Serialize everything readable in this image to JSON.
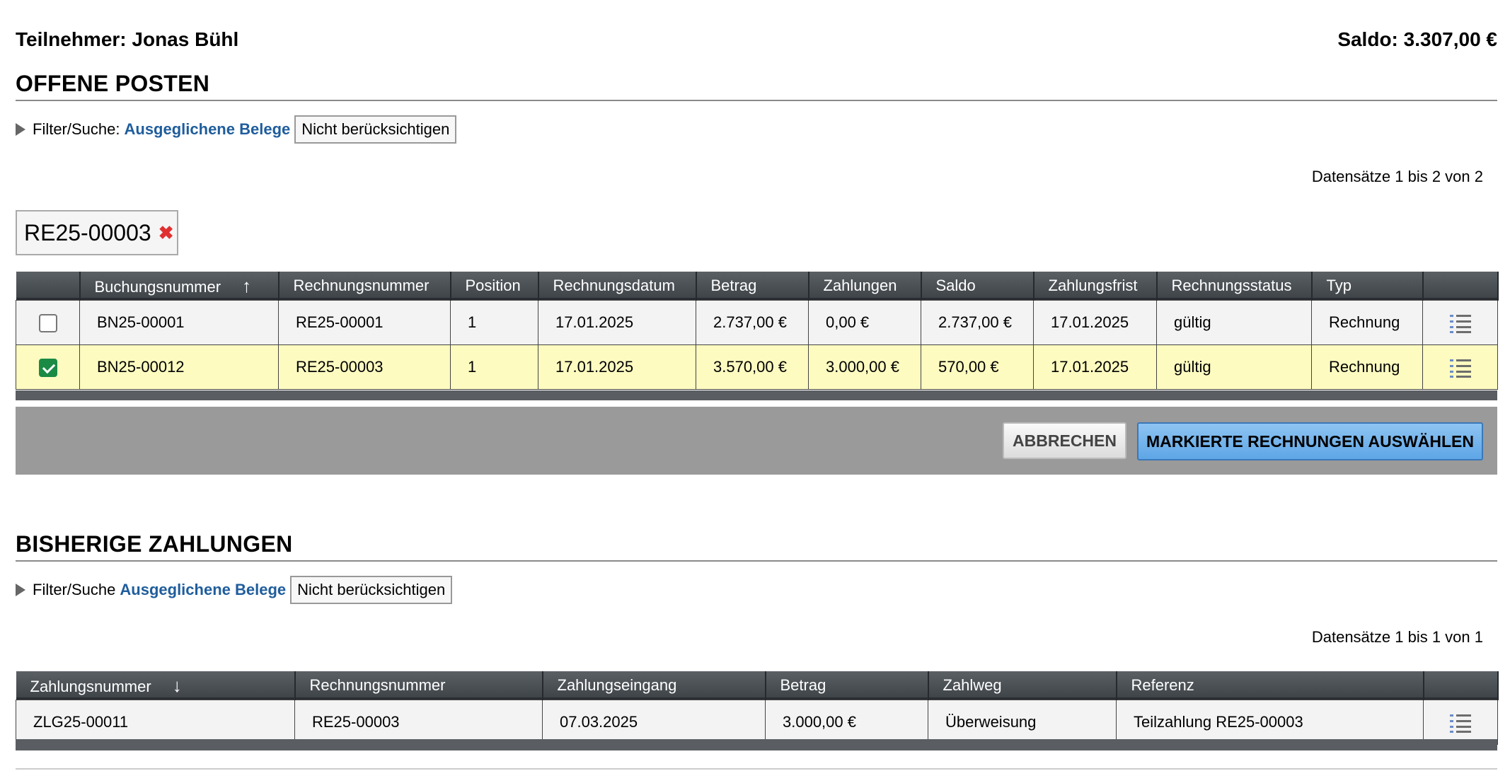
{
  "header": {
    "participant": "Teilnehmer: Jonas Bühl",
    "saldo": "Saldo: 3.307,00 €"
  },
  "offene_posten": {
    "title": "OFFENE POSTEN",
    "filter_label": "Filter/Suche:",
    "filter_link": "Ausgeglichene Belege",
    "filter_button": "Nicht berücksichtigen",
    "records": "Datensätze 1 bis 2 von 2",
    "chip": "RE25-00003",
    "chip_remove": "✖",
    "sort_arrow": "↑",
    "columns": [
      "Buchungsnummer",
      "Rechnungsnummer",
      "Position",
      "Rechnungsdatum",
      "Betrag",
      "Zahlungen",
      "Saldo",
      "Zahlungsfrist",
      "Rechnungsstatus",
      "Typ"
    ],
    "rows": [
      {
        "checked": false,
        "cells": [
          "BN25-00001",
          "RE25-00001",
          "1",
          "17.01.2025",
          "2.737,00 €",
          "0,00 €",
          "2.737,00 €",
          "17.01.2025",
          "gültig",
          "Rechnung"
        ]
      },
      {
        "checked": true,
        "cells": [
          "BN25-00012",
          "RE25-00003",
          "1",
          "17.01.2025",
          "3.570,00 €",
          "3.000,00 €",
          "570,00 €",
          "17.01.2025",
          "gültig",
          "Rechnung"
        ]
      }
    ],
    "cancel_button": "ABBRECHEN",
    "select_button": "MARKIERTE RECHNUNGEN AUSWÄHLEN"
  },
  "bisherige_zahlungen": {
    "title": "BISHERIGE ZAHLUNGEN",
    "filter_label": "Filter/Suche",
    "filter_link": "Ausgeglichene Belege",
    "filter_button": "Nicht berücksichtigen",
    "records": "Datensätze 1 bis 1 von 1",
    "sort_arrow": "↓",
    "columns": [
      "Zahlungsnummer",
      "Rechnungsnummer",
      "Zahlungseingang",
      "Betrag",
      "Zahlweg",
      "Referenz"
    ],
    "rows": [
      {
        "cells": [
          "ZLG25-00011",
          "RE25-00003",
          "07.03.2025",
          "3.000,00 €",
          "Überweisung",
          "Teilzahlung RE25-00003"
        ]
      }
    ]
  },
  "colors": {
    "header_dark": "#3d4247",
    "selected_row": "#fdfbc0",
    "link": "#1f5d9c",
    "primary_button": "#5ea6e6",
    "remove_x": "#e03030",
    "checkbox_checked": "#1a8a45"
  },
  "icons": {
    "row_menu": "list-icon",
    "filter_toggle": "triangle-right-icon",
    "chip_remove": "close-icon"
  }
}
